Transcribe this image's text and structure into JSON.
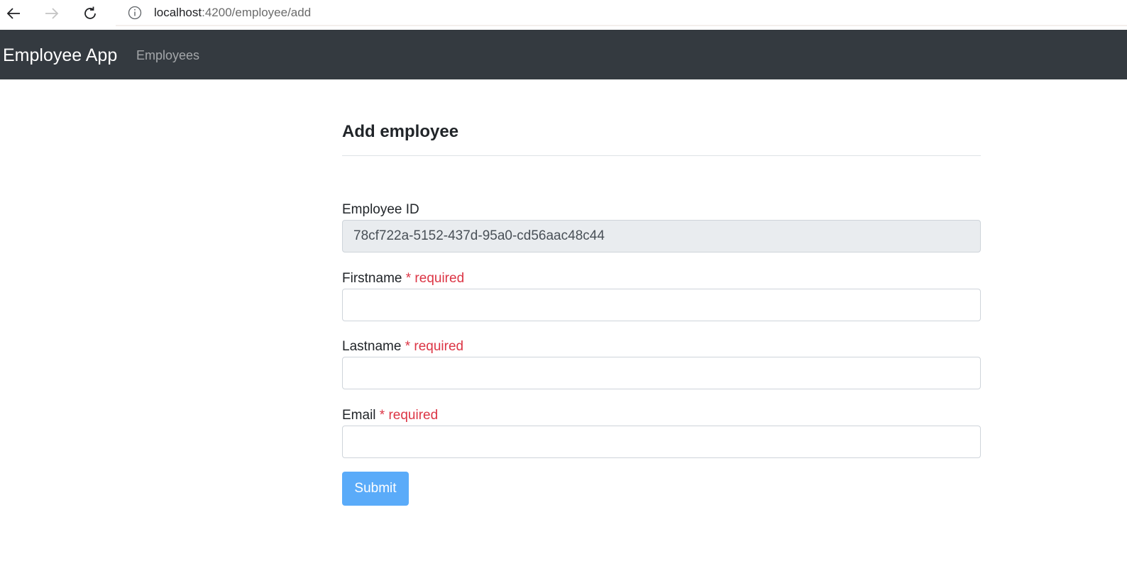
{
  "browser": {
    "url_host": "localhost",
    "url_path": ":4200/employee/add"
  },
  "navbar": {
    "brand": "Employee App",
    "links": [
      {
        "label": "Employees"
      }
    ]
  },
  "form": {
    "title": "Add employee",
    "fields": [
      {
        "label": "Employee ID",
        "value": "78cf722a-5152-437d-95a0-cd56aac48c44",
        "readonly": true
      },
      {
        "label": "Firstname",
        "required": "* required",
        "value": ""
      },
      {
        "label": "Lastname",
        "required": "* required",
        "value": ""
      },
      {
        "label": "Email",
        "required": "* required",
        "value": ""
      }
    ],
    "submit_label": "Submit"
  },
  "colors": {
    "navbar_bg": "#343a40",
    "required": "#dc3545",
    "submit_bg": "#5aabf9",
    "readonly_bg": "#e9ecef"
  }
}
